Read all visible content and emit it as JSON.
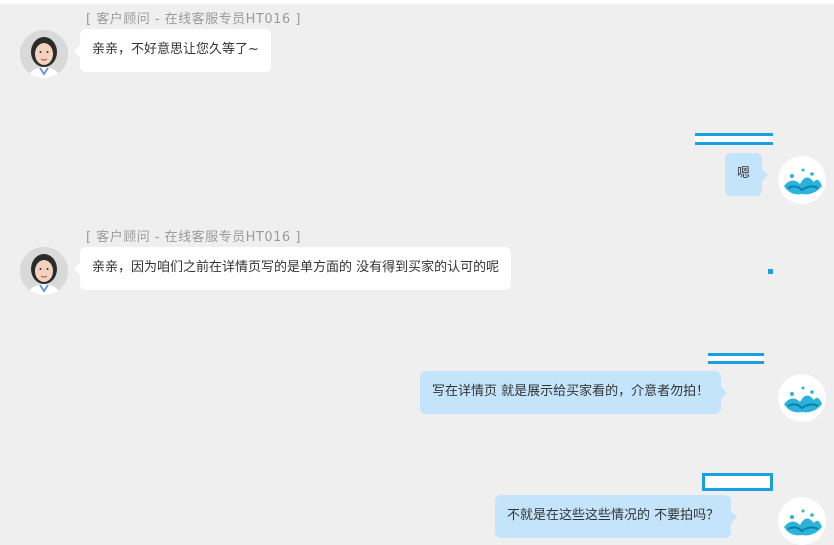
{
  "messages": [
    {
      "sender": "agent",
      "label": "[ 客户顾问  -  在线客服专员HT016 ]",
      "text": "亲亲，不好意思让您久等了~"
    },
    {
      "sender": "user",
      "text": "嗯"
    },
    {
      "sender": "agent",
      "label": "[ 客户顾问  -  在线客服专员HT016 ]",
      "text": "亲亲，因为咱们之前在详情页写的是单方面的 没有得到买家的认可的呢"
    },
    {
      "sender": "user",
      "text": "写在详情页 就是展示给买家看的，介意者勿拍！"
    },
    {
      "sender": "user",
      "text": "不就是在这些这些情况的 不要拍吗？"
    }
  ],
  "colors": {
    "background": "#efefef",
    "agent_bubble": "#ffffff",
    "user_bubble": "#c3e4fb",
    "redaction": "#19a0e0"
  },
  "icons": {
    "agent_avatar": "agent-avatar-woman",
    "user_avatar": "user-avatar-water-splash"
  }
}
